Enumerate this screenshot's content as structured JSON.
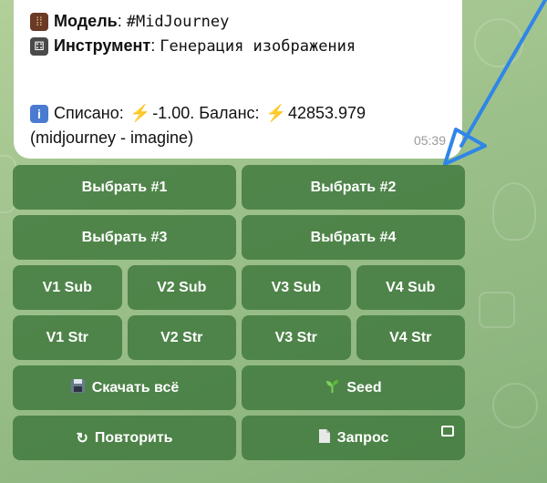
{
  "message": {
    "model_label": "Модель",
    "model_value": "#MidJourney",
    "tool_label": "Инструмент",
    "tool_value": "Генерация изображения",
    "charged_label": "Списано:",
    "charged_value": "-1.00.",
    "balance_label": "Баланс:",
    "balance_value": "42853.979",
    "source": "(midjourney - imagine)",
    "time": "05:39"
  },
  "keyboard": {
    "select_1": "Выбрать #1",
    "select_2": "Выбрать #2",
    "select_3": "Выбрать #3",
    "select_4": "Выбрать #4",
    "v1_sub": "V1 Sub",
    "v2_sub": "V2 Sub",
    "v3_sub": "V3 Sub",
    "v4_sub": "V4 Sub",
    "v1_str": "V1 Str",
    "v2_str": "V2 Str",
    "v3_str": "V3 Str",
    "v4_str": "V4 Str",
    "download_all": "Скачать всё",
    "seed": "Seed",
    "repeat": "Повторить",
    "request": "Запрос"
  },
  "icons": {
    "model": "abacus-icon",
    "tool": "dice-icon",
    "info": "info-icon",
    "bolt": "lightning-icon",
    "download": "floppy-disk-icon",
    "seed": "seedling-icon",
    "repeat": "refresh-icon",
    "request": "document-icon"
  },
  "colors": {
    "button_bg": "#3e783c",
    "background": "#a8c890",
    "arrow": "#2f86e8"
  }
}
